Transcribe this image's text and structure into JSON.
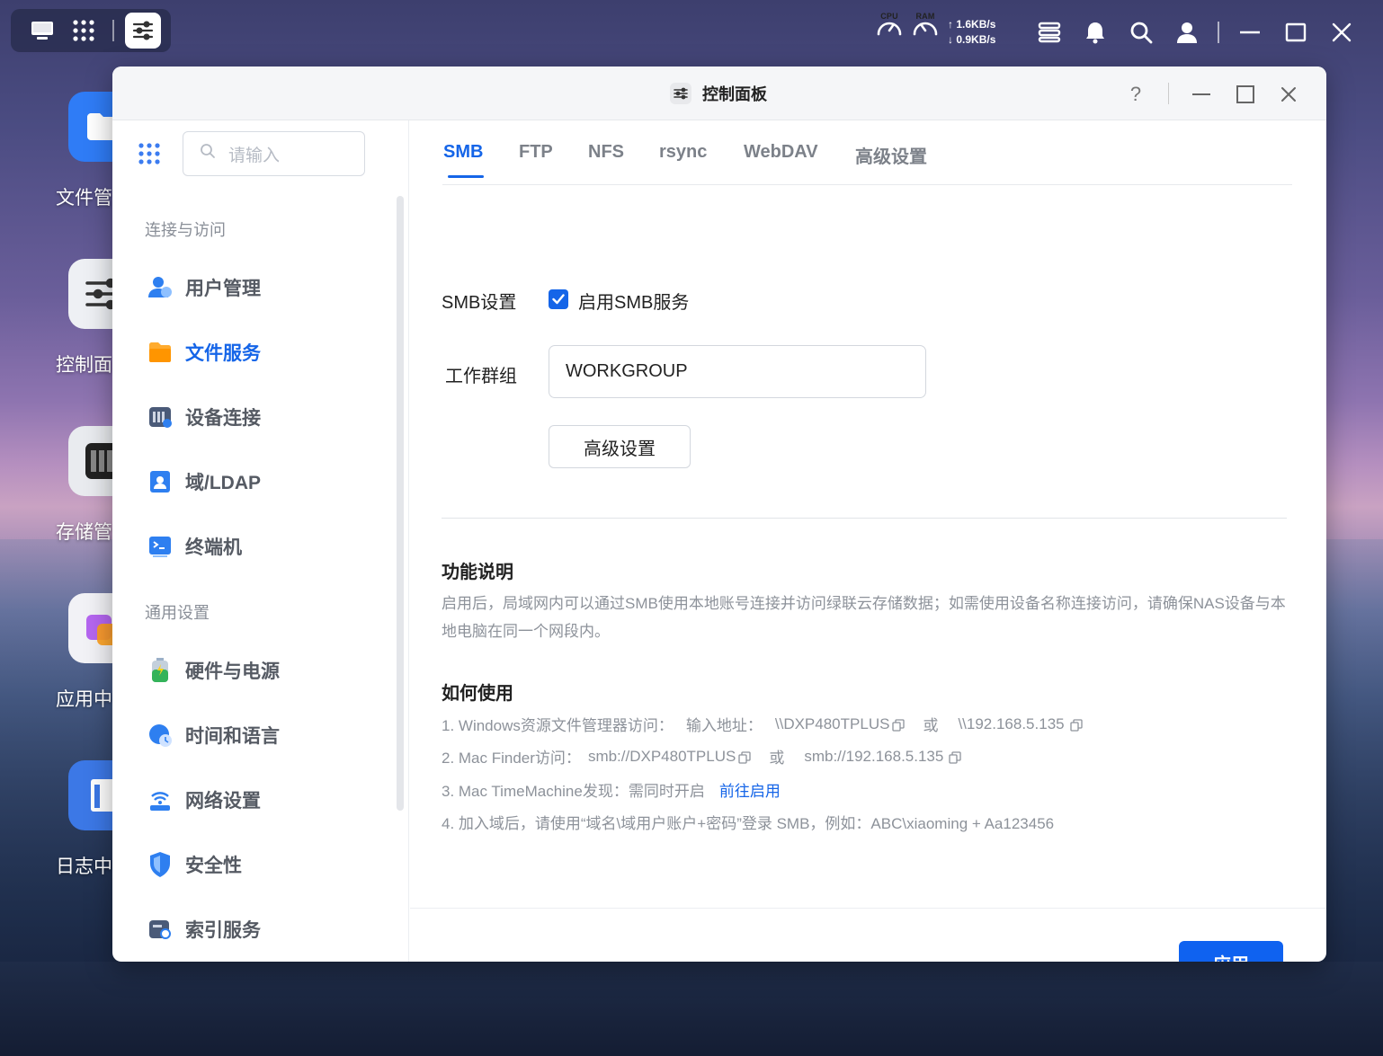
{
  "topbar": {
    "cpu_label": "CPU",
    "ram_label": "RAM",
    "upload_speed": "1.6KB/s",
    "download_speed": "0.9KB/s",
    "icons": [
      "monitor-icon",
      "apps-grid-icon",
      "control-panel-icon",
      "server-icon",
      "bell-icon",
      "search-icon",
      "user-icon",
      "minimize-icon",
      "maximize-icon",
      "close-icon"
    ]
  },
  "desktop": {
    "icons": [
      {
        "label": "文件管",
        "icon": "folder-icon"
      },
      {
        "label": "控制面",
        "icon": "control-panel-icon"
      },
      {
        "label": "存储管",
        "icon": "storage-icon"
      },
      {
        "label": "应用中",
        "icon": "app-center-icon"
      },
      {
        "label": "日志中",
        "icon": "log-icon"
      }
    ]
  },
  "window": {
    "title": "控制面板",
    "help": "?"
  },
  "sidebar": {
    "search_placeholder": "请输入",
    "groups": [
      {
        "title": "连接与访问",
        "items": [
          {
            "label": "用户管理",
            "icon": "users-icon",
            "active": false
          },
          {
            "label": "文件服务",
            "icon": "folder-icon",
            "active": true
          },
          {
            "label": "设备连接",
            "icon": "device-icon",
            "active": false
          },
          {
            "label": "域/LDAP",
            "icon": "ldap-icon",
            "active": false
          },
          {
            "label": "终端机",
            "icon": "terminal-icon",
            "active": false
          }
        ]
      },
      {
        "title": "通用设置",
        "items": [
          {
            "label": "硬件与电源",
            "icon": "battery-icon",
            "active": false
          },
          {
            "label": "时间和语言",
            "icon": "globe-clock-icon",
            "active": false
          },
          {
            "label": "网络设置",
            "icon": "network-icon",
            "active": false
          },
          {
            "label": "安全性",
            "icon": "shield-icon",
            "active": false
          },
          {
            "label": "索引服务",
            "icon": "index-icon",
            "active": false
          }
        ]
      }
    ]
  },
  "main": {
    "tabs": [
      {
        "label": "SMB",
        "active": true
      },
      {
        "label": "FTP",
        "active": false
      },
      {
        "label": "NFS",
        "active": false
      },
      {
        "label": "rsync",
        "active": false
      },
      {
        "label": "WebDAV",
        "active": false
      },
      {
        "label": "高级设置",
        "active": false
      }
    ],
    "smb_setting_label": "SMB设置",
    "enable_smb_label": "启用SMB服务",
    "enable_smb_checked": true,
    "workgroup_label": "工作群组",
    "workgroup_value": "WORKGROUP",
    "advanced_button": "高级设置",
    "func_title": "功能说明",
    "func_desc": "启用后，局域网内可以通过SMB使用本地账号连接并访问绿联云存储数据；如需使用设备名称连接访问，请确保NAS设备与本地电脑在同一个网段内。",
    "howto_title": "如何使用",
    "steps": {
      "s1_prefix": "1. Windows资源文件管理器访问：",
      "s1_addr_label": "输入地址：",
      "s1_addr1": "\\\\DXP480TPLUS",
      "s1_or": "或",
      "s1_addr2": "\\\\192.168.5.135",
      "s2_prefix": "2. Mac Finder访问：",
      "s2_addr1": "smb://DXP480TPLUS",
      "s2_or": "或",
      "s2_addr2": "smb://192.168.5.135",
      "s3_prefix": "3. Mac TimeMachine发现：需同时开启",
      "s3_link": "前往启用",
      "s4_text": "4. 加入域后，请使用“域名\\域用户账户+密码”登录 SMB，例如：ABC\\xiaoming + Aa123456"
    },
    "apply_button": "应用"
  },
  "colors": {
    "accent": "#1565e8",
    "apply": "#0f62f0"
  }
}
